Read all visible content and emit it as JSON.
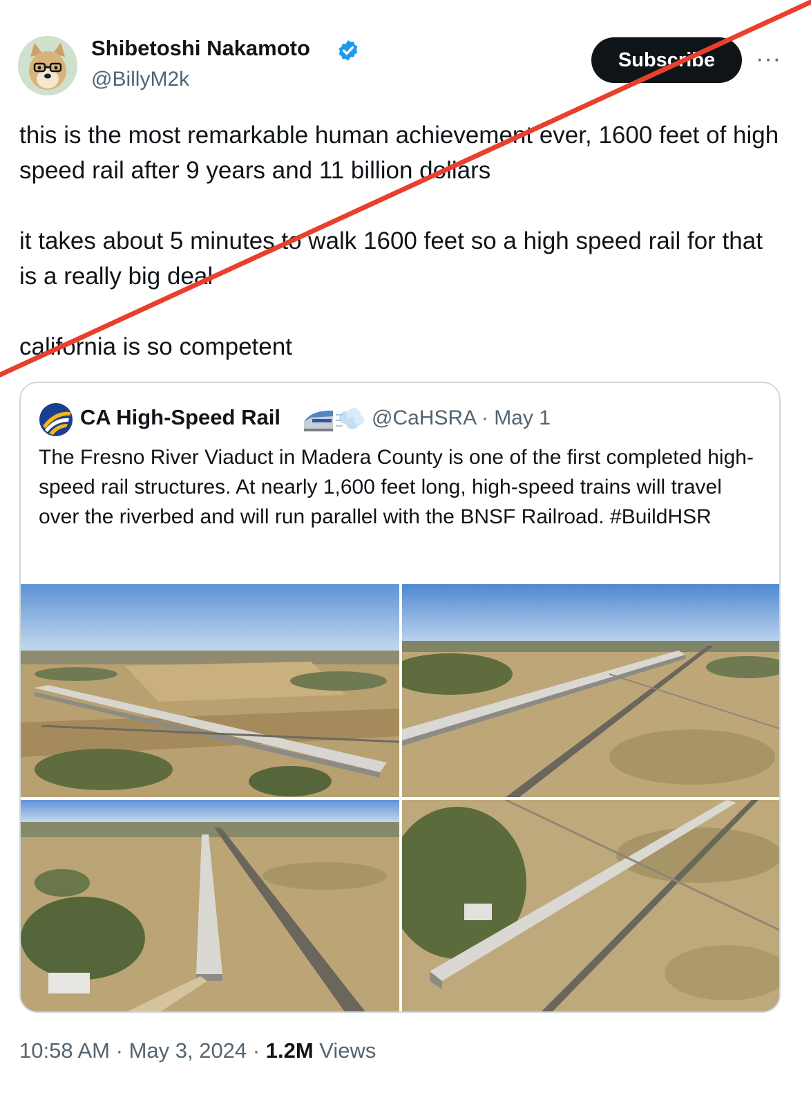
{
  "tweet": {
    "author_name": "Shibetoshi Nakamoto",
    "author_handle": "@BillyM2k",
    "subscribe_label": "Subscribe",
    "more_label": "···",
    "paragraphs": [
      "this is the most remarkable human achievement ever, 1600 feet of high speed rail after 9 years and 11 billion dollars",
      "it takes about 5 minutes to walk 1600 feet so a high speed rail for that is a really big deal",
      "california is so competent"
    ],
    "time": "10:58 AM",
    "date": "May 3, 2024",
    "views_count": "1.2M",
    "views_label": "Views",
    "separator": "·"
  },
  "quoted": {
    "author_name": "CA High-Speed Rail",
    "author_handle": "@CaHSRA",
    "date": "May 1",
    "separator": "·",
    "text": "The Fresno River Viaduct in Madera County is one of the first completed high-speed rail structures. At nearly 1,600 feet long, high-speed trains will travel over the riverbed and will run parallel with the BNSF Railroad. #BuildHSR"
  },
  "colors": {
    "text": "#0f1419",
    "secondary": "#536471",
    "verified": "#1d9bf0",
    "strike_line": "#e8402c",
    "border": "#cfd9de"
  },
  "icons": [
    "doge-avatar",
    "verified-badge-icon",
    "cahsr-logo-icon",
    "train-emoji-icon",
    "dash-emoji-icon",
    "more-icon"
  ]
}
